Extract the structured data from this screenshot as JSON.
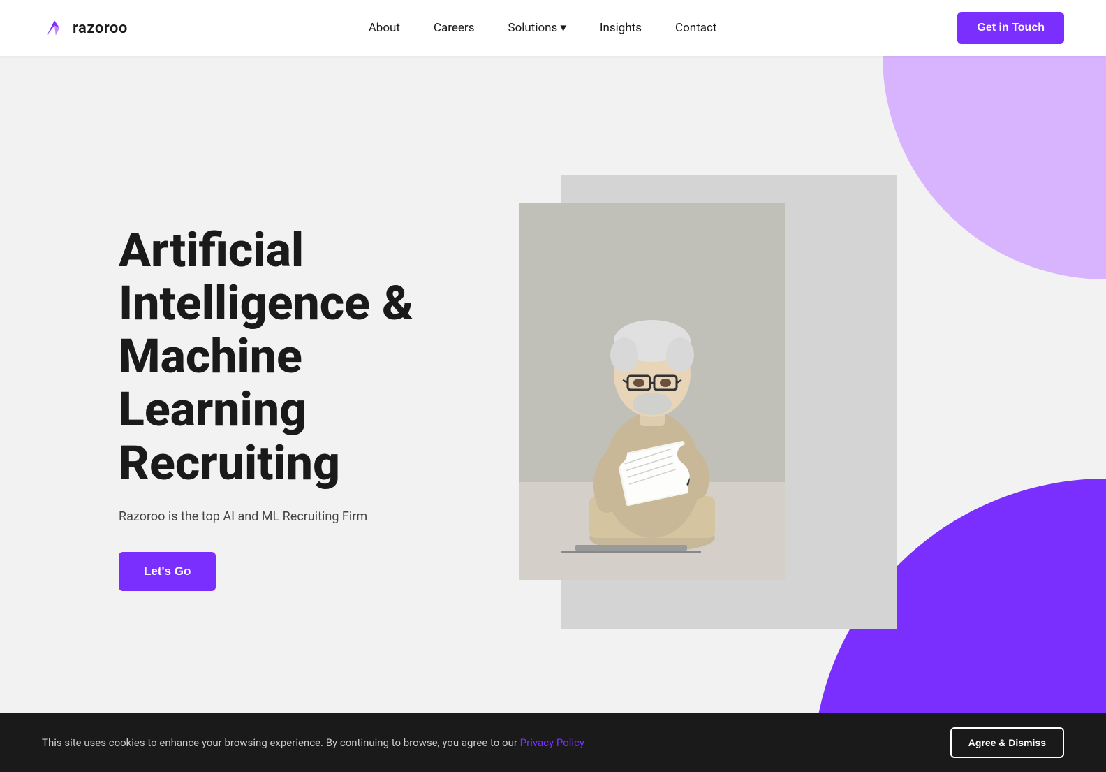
{
  "brand": {
    "name": "razoroo",
    "logo_alt": "Razoroo logo"
  },
  "navbar": {
    "links": [
      {
        "id": "about",
        "label": "About"
      },
      {
        "id": "careers",
        "label": "Careers"
      },
      {
        "id": "solutions",
        "label": "Solutions"
      },
      {
        "id": "insights",
        "label": "Insights"
      },
      {
        "id": "contact",
        "label": "Contact"
      }
    ],
    "cta_label": "Get in Touch"
  },
  "hero": {
    "title": "Artificial Intelligence & Machine Learning Recruiting",
    "subtitle": "Razoroo is the top AI and ML Recruiting Firm",
    "cta_label": "Let's Go"
  },
  "cookie": {
    "text": "This site uses cookies to enhance your browsing experience. By continuing to browse, you agree to our ",
    "link_text": "Privacy Policy",
    "dismiss_label": "Agree & Dismiss"
  }
}
